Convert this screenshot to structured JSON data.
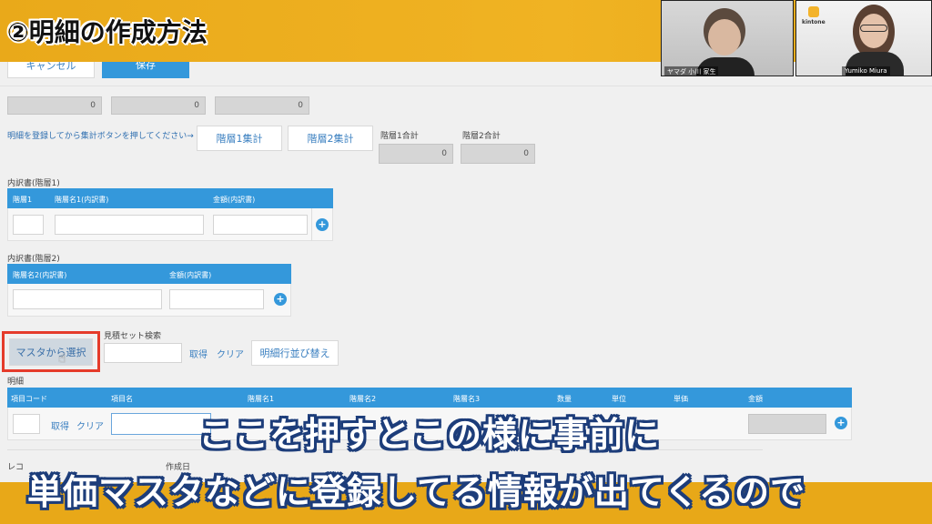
{
  "banner": {
    "title": "②明細の作成方法"
  },
  "video": {
    "left_name": "ヤマダ 小川 家生",
    "right_name": "Yumiko Miura",
    "right_logo": "kintone"
  },
  "toolbar": {
    "cancel_label": "キャンセル",
    "save_label": "保存"
  },
  "top_fields": {
    "f1": "0",
    "f2": "0",
    "f3": "0"
  },
  "aggregate": {
    "hint": "明細を登録してから集計ボタンを押してください→",
    "btn1": "階層1集計",
    "btn2": "階層2集計",
    "total1_label": "階層1合計",
    "total1_value": "0",
    "total2_label": "階層2合計",
    "total2_value": "0"
  },
  "breakdown1": {
    "title": "内訳書(階層1)",
    "col1": "階層1",
    "col2": "階層名1(内訳書)",
    "col3": "金額(内訳書)",
    "add": "+"
  },
  "breakdown2": {
    "title": "内訳書(階層2)",
    "col1": "階層名2(内訳書)",
    "col2": "金額(内訳書)",
    "add": "+"
  },
  "master": {
    "select_label": "マスタから選択",
    "estimate_search_label": "見積セット検索",
    "fetch": "取得",
    "clear": "クリア",
    "reorder": "明細行並び替え"
  },
  "details": {
    "title": "明細",
    "cols": [
      "項目コード",
      "項目名",
      "階層名1",
      "階層名2",
      "階層名3",
      "数量",
      "単位",
      "単価",
      "金額"
    ],
    "fetch": "取得",
    "clear": "クリア",
    "add": "+"
  },
  "footer_fragments": {
    "a": "レコ",
    "b": "作成日"
  },
  "subtitles": {
    "line1": "ここを押すとこの様に事前に",
    "line2": "単価マスタなどに登録してる情報が出てくるので"
  }
}
